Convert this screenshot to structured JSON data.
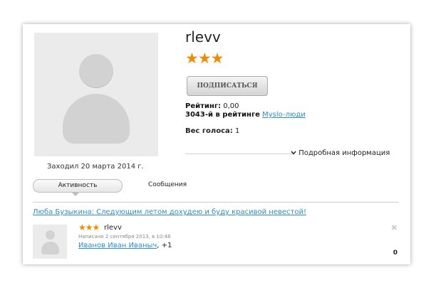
{
  "profile": {
    "username": "rlevv",
    "stars": "★★★",
    "subscribe_label": "ПОДПИСАТЬСЯ",
    "rating_label": "Рейтинг:",
    "rating_value": "0,00",
    "rank_text": "3043-й в рейтинге",
    "rank_link": "Myslo-люди",
    "vote_label": "Вес голоса:",
    "vote_value": "1",
    "last_visit": "Заходил 20 марта 2014 г.",
    "more_info_icon": "chevron-down",
    "more_info_label": "Подробная информация"
  },
  "tabs": {
    "activity": "Активность",
    "messages": "Сообщения"
  },
  "activity": {
    "link": "Люба Бузыкина: Следующим летом дохудею и буду красивой невестой!",
    "item": {
      "stars": "★★★",
      "user": "rlevv",
      "date": "Написано 2 сентября 2013, в 10:46",
      "author_link": "Иванов Иван Иваныч",
      "extra": ", +1",
      "count": "0",
      "close_icon": "✖"
    }
  },
  "colors": {
    "accent_star": "#f08a00",
    "link": "#2a8fc7"
  }
}
